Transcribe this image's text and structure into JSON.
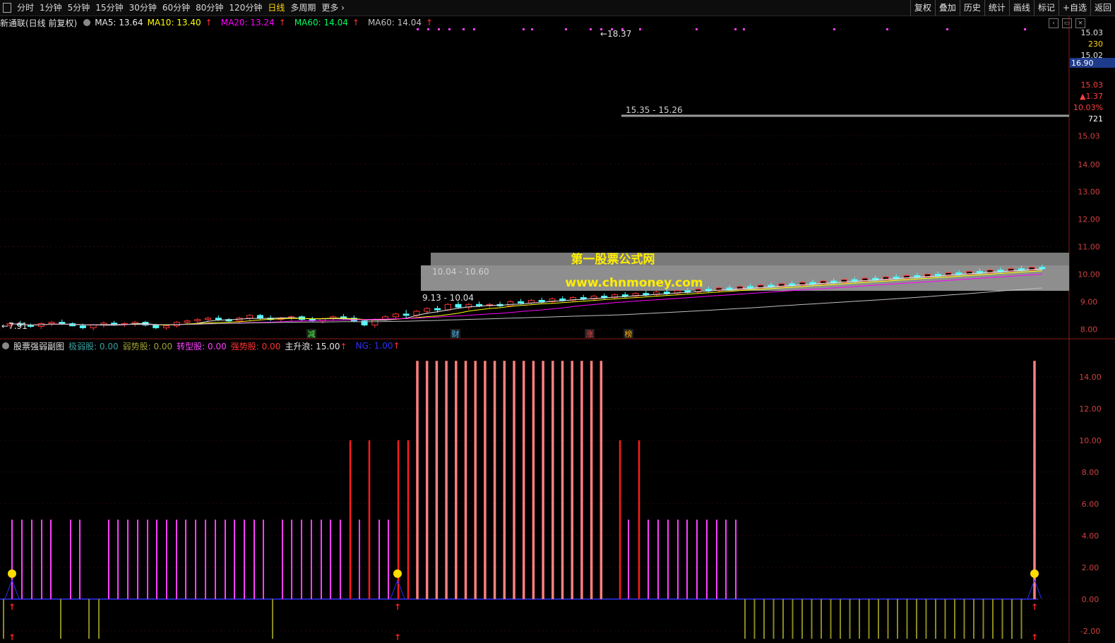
{
  "toolbar": {
    "periods": [
      "分时",
      "1分钟",
      "5分钟",
      "15分钟",
      "30分钟",
      "60分钟",
      "80分钟",
      "120分钟",
      "日线",
      "多周期",
      "更多"
    ],
    "active": "日线",
    "buttons": [
      "复权",
      "叠加",
      "历史",
      "统计",
      "画线",
      "标记",
      "+自选",
      "返回"
    ]
  },
  "main_legend": {
    "name": "新通联(日线 前复权)",
    "ma5": "MA5: 13.64",
    "ma10": "MA10: 13.40",
    "ma20": "MA20: 13.24",
    "ma60a": "MA60: 14.04",
    "ma60b": "MA60: 14.04"
  },
  "sub_legend": {
    "name": "股票强弱副图",
    "items": [
      {
        "label": "极弱股: 0.00",
        "color": "#3aa0a0"
      },
      {
        "label": "弱势股: 0.00",
        "color": "#a0a030"
      },
      {
        "label": "转型股: 0.00",
        "color": "#ff40ff"
      },
      {
        "label": "强势股: 0.00",
        "color": "#ff3030"
      },
      {
        "label": "主升浪: 15.00",
        "color": "#e8e8e8"
      },
      {
        "label": "NG: 1.00",
        "color": "#3030ff"
      }
    ]
  },
  "right_axis": {
    "main_ticks": [
      "15.03",
      "14.00",
      "13.00",
      "12.00",
      "11.00",
      "10.00",
      "9.00",
      "8.00"
    ],
    "sub_ticks": [
      "14.00",
      "12.00",
      "10.00",
      "8.00",
      "6.00",
      "4.00",
      "2.00",
      "0.00",
      "-2.00"
    ],
    "info": [
      {
        "text": "15.03",
        "color": "#e0e0e0"
      },
      {
        "text": "230",
        "color": "#ffd700"
      },
      {
        "text": "15.02",
        "color": "#e0e0e0"
      },
      {
        "text": "16.90",
        "color": "#ffffff",
        "bg": "#1e3a8a"
      },
      {
        "text": "15.03",
        "color": "#ff4040"
      },
      {
        "text": "1.37",
        "color": "#ff4040"
      },
      {
        "text": "10.03%",
        "color": "#ff4040"
      },
      {
        "text": "721",
        "color": "#ffffff"
      }
    ]
  },
  "annotations": {
    "high": "18.37",
    "low": "7.91",
    "zone_high": "15.35 - 15.26",
    "zone_mid": "10.04 - 10.60",
    "zone_low": "9.13 - 10.04",
    "events": [
      "减",
      "财",
      "涨",
      "榜"
    ],
    "watermark_cn": "第一股票公式网",
    "watermark_url": "www.chnmoney.com"
  },
  "colors": {
    "up": "#ff3333",
    "down": "#54fcfc",
    "ma5": "#e8e8e8",
    "ma10": "#ffff00",
    "ma20": "#ff00ff",
    "ma60": "#bfbfbf"
  },
  "chart_data": [
    {
      "type": "candlestick",
      "title": "新通联(日线 前复权)",
      "xlabel": "",
      "ylabel": "",
      "ylim": [
        7.7,
        18.9
      ],
      "grid": true,
      "ohlc": [
        [
          8.15,
          8.25,
          8.05,
          8.2
        ],
        [
          8.2,
          8.3,
          8.1,
          8.15
        ],
        [
          8.15,
          8.2,
          8.05,
          8.1
        ],
        [
          8.1,
          8.25,
          8.0,
          8.2
        ],
        [
          8.2,
          8.3,
          8.1,
          8.25
        ],
        [
          8.25,
          8.35,
          8.15,
          8.2
        ],
        [
          8.2,
          8.25,
          8.1,
          8.12
        ],
        [
          8.12,
          8.2,
          8.0,
          8.05
        ],
        [
          8.05,
          8.18,
          7.95,
          8.15
        ],
        [
          8.15,
          8.28,
          8.05,
          8.22
        ],
        [
          8.22,
          8.3,
          8.12,
          8.18
        ],
        [
          8.18,
          8.25,
          8.08,
          8.2
        ],
        [
          8.2,
          8.3,
          8.1,
          8.25
        ],
        [
          8.25,
          8.3,
          8.1,
          8.15
        ],
        [
          8.15,
          8.2,
          8.0,
          8.05
        ],
        [
          8.05,
          8.15,
          7.98,
          8.12
        ],
        [
          8.12,
          8.3,
          8.05,
          8.25
        ],
        [
          8.25,
          8.35,
          8.15,
          8.3
        ],
        [
          8.3,
          8.4,
          8.2,
          8.35
        ],
        [
          8.35,
          8.45,
          8.25,
          8.4
        ],
        [
          8.4,
          8.5,
          8.3,
          8.35
        ],
        [
          8.35,
          8.4,
          8.25,
          8.3
        ],
        [
          8.3,
          8.45,
          8.22,
          8.4
        ],
        [
          8.4,
          8.55,
          8.3,
          8.5
        ],
        [
          8.5,
          8.55,
          8.35,
          8.4
        ],
        [
          8.4,
          8.5,
          8.3,
          8.35
        ],
        [
          8.35,
          8.45,
          8.25,
          8.4
        ],
        [
          8.4,
          8.5,
          8.3,
          8.45
        ],
        [
          8.45,
          8.5,
          8.3,
          8.35
        ],
        [
          8.35,
          8.45,
          8.25,
          8.3
        ],
        [
          8.3,
          8.42,
          8.2,
          8.38
        ],
        [
          8.38,
          8.5,
          8.3,
          8.45
        ],
        [
          8.45,
          8.55,
          8.35,
          8.4
        ],
        [
          8.4,
          8.5,
          8.25,
          8.3
        ],
        [
          8.3,
          8.35,
          8.1,
          8.15
        ],
        [
          8.15,
          8.4,
          8.05,
          8.35
        ],
        [
          8.35,
          8.5,
          8.3,
          8.45
        ],
        [
          8.45,
          8.6,
          8.35,
          8.55
        ],
        [
          8.55,
          8.7,
          8.4,
          8.5
        ],
        [
          8.5,
          8.7,
          8.45,
          8.65
        ],
        [
          8.65,
          8.8,
          8.55,
          8.75
        ],
        [
          8.75,
          8.85,
          8.6,
          8.7
        ],
        [
          8.7,
          8.95,
          8.65,
          8.9
        ],
        [
          8.9,
          9.0,
          8.75,
          8.8
        ],
        [
          8.8,
          8.95,
          8.7,
          8.9
        ],
        [
          8.9,
          9.0,
          8.8,
          8.85
        ],
        [
          8.85,
          8.95,
          8.75,
          8.9
        ],
        [
          8.9,
          9.0,
          8.8,
          8.85
        ],
        [
          8.85,
          9.05,
          8.8,
          9.0
        ],
        [
          9.0,
          9.1,
          8.9,
          8.95
        ],
        [
          8.95,
          9.1,
          8.9,
          9.05
        ],
        [
          9.05,
          9.15,
          8.95,
          9.0
        ],
        [
          9.0,
          9.15,
          8.95,
          9.1
        ],
        [
          9.1,
          9.2,
          9.0,
          9.05
        ],
        [
          9.05,
          9.2,
          9.0,
          9.15
        ],
        [
          9.15,
          9.25,
          9.05,
          9.1
        ],
        [
          9.1,
          9.25,
          9.05,
          9.2
        ],
        [
          9.2,
          9.3,
          9.1,
          9.15
        ],
        [
          9.15,
          9.3,
          9.1,
          9.25
        ],
        [
          9.25,
          9.35,
          9.15,
          9.2
        ],
        [
          9.2,
          9.35,
          9.15,
          9.3
        ],
        [
          9.3,
          9.4,
          9.2,
          9.25
        ],
        [
          9.25,
          9.4,
          9.2,
          9.35
        ],
        [
          9.35,
          9.45,
          9.25,
          9.3
        ],
        [
          9.3,
          9.45,
          9.25,
          9.4
        ],
        [
          9.4,
          9.5,
          9.3,
          9.35
        ],
        [
          9.35,
          9.5,
          9.3,
          9.45
        ],
        [
          9.45,
          9.55,
          9.35,
          9.4
        ],
        [
          9.4,
          9.55,
          9.35,
          9.5
        ],
        [
          9.5,
          9.6,
          9.4,
          9.45
        ],
        [
          9.45,
          9.6,
          9.4,
          9.55
        ],
        [
          9.55,
          9.65,
          9.45,
          9.5
        ],
        [
          9.5,
          9.65,
          9.45,
          9.6
        ],
        [
          9.6,
          9.7,
          9.5,
          9.55
        ],
        [
          9.55,
          9.7,
          9.5,
          9.65
        ],
        [
          9.65,
          9.75,
          9.55,
          9.6
        ],
        [
          9.6,
          9.75,
          9.55,
          9.7
        ],
        [
          9.7,
          9.8,
          9.6,
          9.65
        ],
        [
          9.65,
          9.8,
          9.6,
          9.75
        ],
        [
          9.75,
          9.85,
          9.65,
          9.7
        ],
        [
          9.7,
          9.85,
          9.65,
          9.8
        ],
        [
          9.8,
          9.9,
          9.7,
          9.75
        ],
        [
          9.75,
          9.9,
          9.7,
          9.85
        ],
        [
          9.85,
          9.95,
          9.75,
          9.8
        ],
        [
          9.8,
          9.95,
          9.75,
          9.9
        ],
        [
          9.9,
          10.0,
          9.8,
          9.85
        ],
        [
          9.85,
          10.0,
          9.8,
          9.95
        ],
        [
          9.95,
          10.05,
          9.85,
          9.9
        ],
        [
          9.9,
          10.05,
          9.85,
          10.0
        ],
        [
          10.0,
          10.1,
          9.9,
          9.95
        ],
        [
          9.95,
          10.1,
          9.9,
          10.05
        ],
        [
          10.05,
          10.15,
          9.95,
          10.0
        ],
        [
          10.0,
          10.15,
          9.95,
          10.1
        ],
        [
          10.1,
          10.2,
          10.0,
          10.05
        ],
        [
          10.05,
          10.2,
          10.0,
          10.15
        ],
        [
          10.15,
          10.25,
          10.05,
          10.1
        ],
        [
          10.1,
          10.25,
          10.05,
          10.2
        ],
        [
          10.2,
          10.3,
          10.1,
          10.15
        ],
        [
          10.15,
          10.3,
          10.1,
          10.25
        ],
        [
          10.25,
          10.35,
          10.15,
          10.2
        ]
      ]
    },
    {
      "type": "bar",
      "title": "股票强弱副图",
      "xlabel": "",
      "ylabel": "",
      "ylim": [
        -2.5,
        15.5
      ],
      "series": [
        {
          "name": "转型股",
          "values": [
            5,
            5,
            5,
            5,
            5,
            5
          ]
        },
        {
          "name": "强势股",
          "values": [
            10,
            10,
            10,
            10
          ]
        },
        {
          "name": "主升浪",
          "values": [
            15,
            15,
            15,
            15,
            15,
            15,
            15,
            15,
            15,
            15
          ]
        },
        {
          "name": "弱势股",
          "values": [
            -2.5,
            -2.5,
            -2.5,
            -2.5
          ]
        }
      ]
    }
  ]
}
